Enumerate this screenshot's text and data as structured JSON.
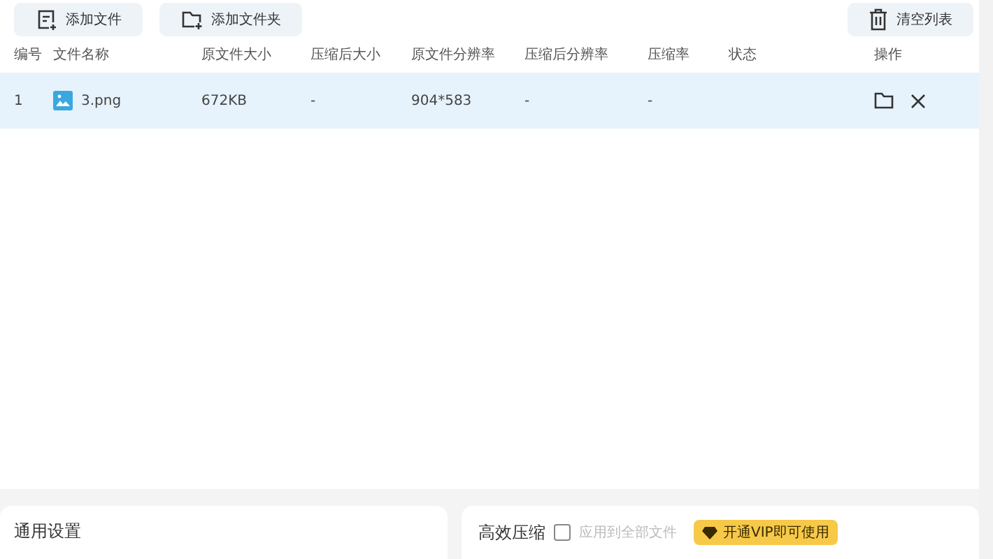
{
  "toolbar": {
    "buttons": [
      {
        "label": "添加文件",
        "kind": "file"
      },
      {
        "label": "添加文件夹",
        "kind": "folder"
      }
    ],
    "clear_button": {
      "label": "清空列表"
    }
  },
  "table": {
    "columns": [
      "编号",
      "文件名称",
      "原文件大小",
      "压缩后大小",
      "原文件分辨率",
      "压缩后分辨率",
      "压缩率",
      "状态",
      "操作"
    ],
    "rows": [
      {
        "index": "1",
        "name": "3.png",
        "original_size": "672KB",
        "compressed_size": "-",
        "original_resolution": "904*583",
        "compressed_resolution": "-",
        "ratio": "-",
        "selected": true
      }
    ]
  },
  "general_settings": {
    "title": "通用设置"
  },
  "efficient_compression": {
    "title": "高效压缩",
    "apply_all": {
      "label": "应用到全部文件",
      "checked": false
    },
    "vip_badge": "开通VIP即可使用"
  }
}
